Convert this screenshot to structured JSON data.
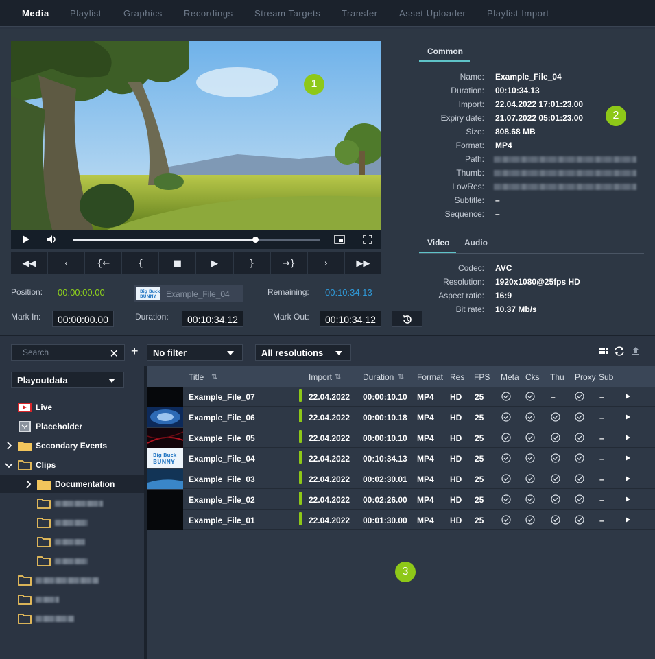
{
  "nav": {
    "tabs": [
      "Media",
      "Playlist",
      "Graphics",
      "Recordings",
      "Stream Targets",
      "Transfer",
      "Asset Uploader",
      "Playlist Import"
    ],
    "active": "Media"
  },
  "player": {
    "position_label": "Position:",
    "position_value": "00:00:00.00",
    "file_name": "Example_File_04",
    "remaining_label": "Remaining:",
    "remaining_value": "00:10:34.13",
    "mark_in_label": "Mark In:",
    "mark_in_value": "00:00:00.00",
    "duration_label": "Duration:",
    "duration_value": "00:10:34.12",
    "mark_out_label": "Mark Out:",
    "mark_out_value": "00:10:34.12",
    "seek_progress": 0.74,
    "transport": [
      "◀◀",
      "‹",
      "{←",
      "{",
      "■",
      "▶",
      "}",
      "→}",
      "›",
      "▶▶"
    ]
  },
  "badges": [
    "1",
    "2",
    "3"
  ],
  "info": {
    "common_tab": "Common",
    "common": [
      {
        "k": "Name:",
        "v": "Example_File_04"
      },
      {
        "k": "Duration:",
        "v": "00:10:34.13"
      },
      {
        "k": "Import:",
        "v": "22.04.2022 17:01:23.00"
      },
      {
        "k": "Expiry date:",
        "v": "21.07.2022 05:01:23.00"
      },
      {
        "k": "Size:",
        "v": "808.68 MB"
      },
      {
        "k": "Format:",
        "v": "MP4"
      },
      {
        "k": "Path:",
        "v": ""
      },
      {
        "k": "Thumb:",
        "v": ""
      },
      {
        "k": "LowRes:",
        "v": ""
      },
      {
        "k": "Subtitle:",
        "v": "–"
      },
      {
        "k": "Sequence:",
        "v": "–"
      }
    ],
    "video_tab": "Video",
    "audio_tab": "Audio",
    "video": [
      {
        "k": "Codec:",
        "v": "AVC"
      },
      {
        "k": "Resolution:",
        "v": "1920x1080@25fps    HD"
      },
      {
        "k": "Aspect ratio:",
        "v": "16:9"
      },
      {
        "k": "Bit rate:",
        "v": "10.37 Mb/s"
      }
    ]
  },
  "filters": {
    "search_placeholder": "Search",
    "filter": "No filter",
    "resolution": "All resolutions"
  },
  "tree": {
    "root": "Playoutdata",
    "items": [
      {
        "label": "Live",
        "icon": "live-icon"
      },
      {
        "label": "Placeholder",
        "icon": "placeholder-icon"
      },
      {
        "label": "Secondary Events",
        "icon": "folder-icon"
      },
      {
        "label": "Clips",
        "icon": "folder-open-icon"
      },
      {
        "label": "Documentation",
        "icon": "folder-icon"
      }
    ]
  },
  "table": {
    "headers": [
      "Title",
      "Import",
      "Duration",
      "Format",
      "Res",
      "FPS",
      "Meta",
      "Cks",
      "Thu",
      "Proxy",
      "Sub"
    ],
    "rows": [
      {
        "title": "Example_File_07",
        "import": "22.04.2022",
        "duration": "00:00:10.10",
        "format": "MP4",
        "res": "HD",
        "fps": "25",
        "thu": "–",
        "sub": "–"
      },
      {
        "title": "Example_File_06",
        "import": "22.04.2022",
        "duration": "00:00:10.18",
        "format": "MP4",
        "res": "HD",
        "fps": "25",
        "thu": "✓",
        "sub": "–"
      },
      {
        "title": "Example_File_05",
        "import": "22.04.2022",
        "duration": "00:00:10.10",
        "format": "MP4",
        "res": "HD",
        "fps": "25",
        "thu": "✓",
        "sub": "–"
      },
      {
        "title": "Example_File_04",
        "import": "22.04.2022",
        "duration": "00:10:34.13",
        "format": "MP4",
        "res": "HD",
        "fps": "25",
        "thu": "✓",
        "sub": "–"
      },
      {
        "title": "Example_File_03",
        "import": "22.04.2022",
        "duration": "00:02:30.01",
        "format": "MP4",
        "res": "HD",
        "fps": "25",
        "thu": "✓",
        "sub": "–"
      },
      {
        "title": "Example_File_02",
        "import": "22.04.2022",
        "duration": "00:02:26.00",
        "format": "MP4",
        "res": "HD",
        "fps": "25",
        "thu": "✓",
        "sub": "–"
      },
      {
        "title": "Example_File_01",
        "import": "22.04.2022",
        "duration": "00:01:30.00",
        "format": "MP4",
        "res": "HD",
        "fps": "25",
        "thu": "✓",
        "sub": "–"
      }
    ]
  },
  "colors": {
    "accent_green": "#8ec818",
    "accent_teal": "#5ec3c8",
    "time_green": "#8ed11c",
    "time_blue": "#2f9ad9"
  }
}
